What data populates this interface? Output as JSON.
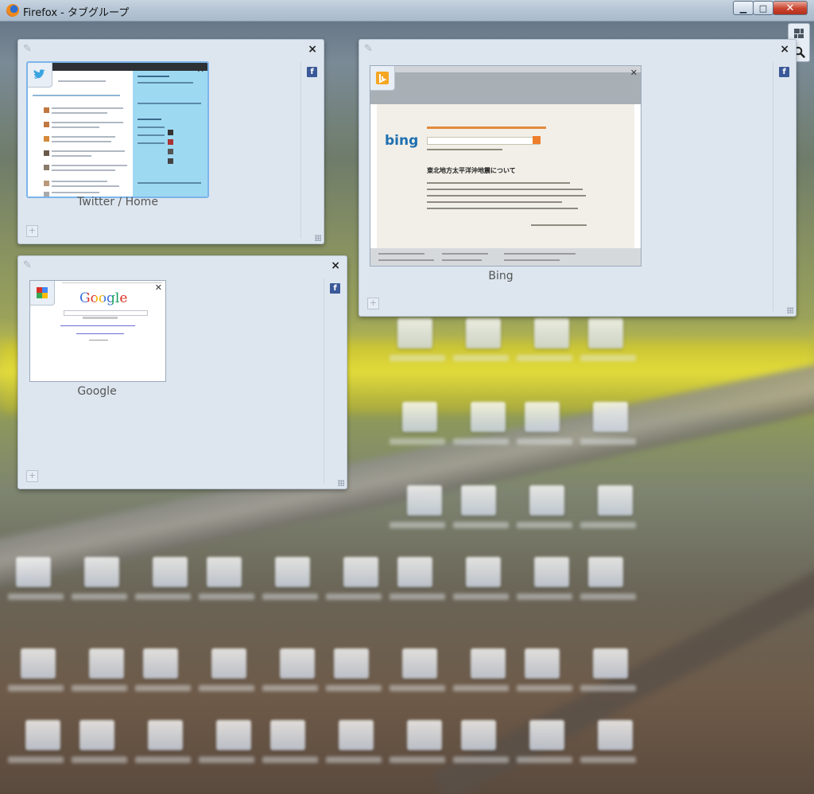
{
  "window": {
    "title": "Firefox - タブグループ",
    "minimize_glyph": "▁",
    "maximize_glyph": "□",
    "close_glyph": "✕"
  },
  "panorama": {
    "groups_icon": "tab-groups-icon",
    "search_icon": "search-icon"
  },
  "groups": [
    {
      "close_glyph": "×",
      "tabs": [
        {
          "label": "Twitter / Home",
          "favicon": "twitter-icon"
        }
      ]
    },
    {
      "close_glyph": "×",
      "tabs": [
        {
          "label": "Bing",
          "favicon": "bing-icon"
        }
      ]
    },
    {
      "close_glyph": "×",
      "tabs": [
        {
          "label": "Google",
          "favicon": "google-icon"
        }
      ]
    }
  ],
  "thumbnails": {
    "bing_logo": "bing",
    "bing_headline": "東北地方太平洋沖地震について",
    "google_logo": "Google"
  },
  "colors": {
    "group_bg": "#dde6ef",
    "facebook": "#3b5998",
    "title_close": "#c8442f"
  }
}
